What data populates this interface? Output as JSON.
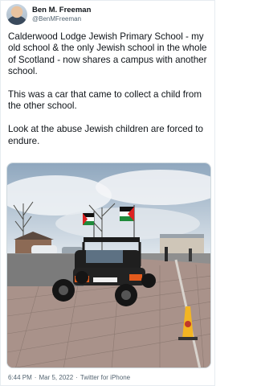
{
  "author": {
    "display_name": "Ben M. Freeman",
    "handle": "@BenMFreeman"
  },
  "tweet": {
    "text": "Calderwood Lodge Jewish Primary School - my old school & the only Jewish school in the whole of Scotland - now shares a campus with another school.\n\nThis was a car that came to collect a child from the other school.\n\nLook at the abuse Jewish children are forced to endure."
  },
  "meta": {
    "time": "6:44 PM",
    "separator1": "·",
    "date": "Mar 5, 2022",
    "separator2": "·",
    "source": "Twitter for iPhone"
  },
  "colors": {
    "text_primary": "#0f1419",
    "text_secondary": "#536471",
    "border": "#cfd9de"
  }
}
